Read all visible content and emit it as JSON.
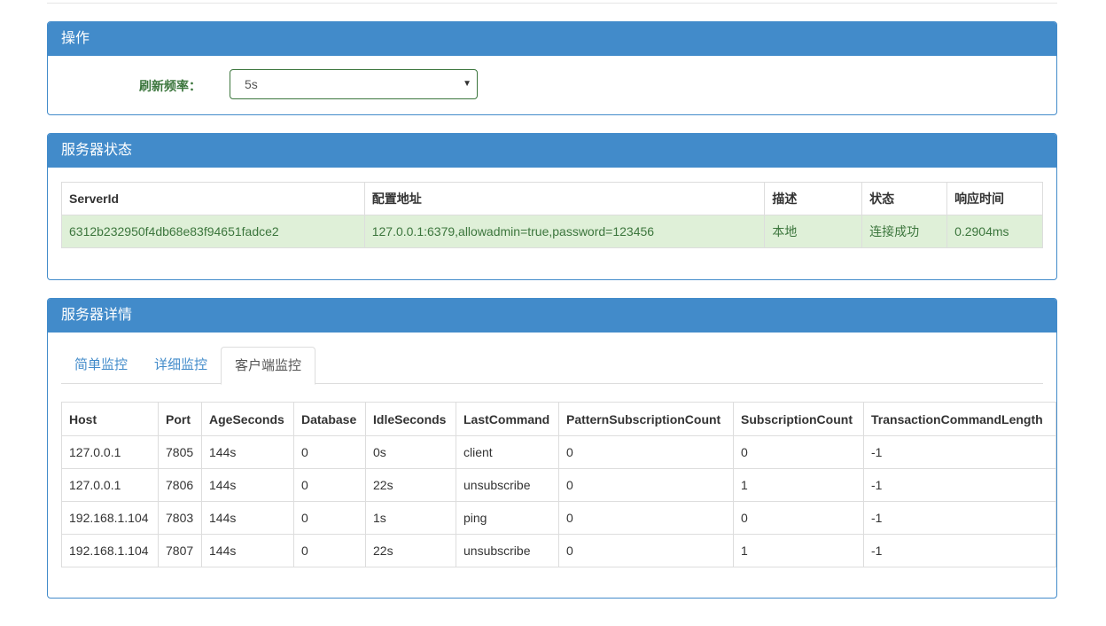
{
  "ops_panel": {
    "title": "操作",
    "refresh_label": "刷新频率：",
    "refresh_value": "5s"
  },
  "status_panel": {
    "title": "服务器状态",
    "headers": [
      "ServerId",
      "配置地址",
      "描述",
      "状态",
      "响应时间"
    ],
    "rows": [
      [
        "6312b232950f4db68e83f94651fadce2",
        "127.0.0.1:6379,allowadmin=true,password=123456",
        "本地",
        "连接成功",
        "0.2904ms"
      ]
    ]
  },
  "details_panel": {
    "title": "服务器详情",
    "tabs": [
      "简单监控",
      "详细监控",
      "客户端监控"
    ],
    "active_tab": 2,
    "headers": [
      "Host",
      "Port",
      "AgeSeconds",
      "Database",
      "IdleSeconds",
      "LastCommand",
      "PatternSubscriptionCount",
      "SubscriptionCount",
      "TransactionCommandLength"
    ],
    "rows": [
      [
        "127.0.0.1",
        "7805",
        "144s",
        "0",
        "0s",
        "client",
        "0",
        "0",
        "-1"
      ],
      [
        "127.0.0.1",
        "7806",
        "144s",
        "0",
        "22s",
        "unsubscribe",
        "0",
        "1",
        "-1"
      ],
      [
        "192.168.1.104",
        "7803",
        "144s",
        "0",
        "1s",
        "ping",
        "0",
        "0",
        "-1"
      ],
      [
        "192.168.1.104",
        "7807",
        "144s",
        "0",
        "22s",
        "unsubscribe",
        "0",
        "1",
        "-1"
      ]
    ]
  },
  "colors": {
    "panel_primary": "#428bca",
    "success_bg": "#dff0d8",
    "success_text": "#3c763d"
  },
  "icons": {
    "select_caret": "caret-down-icon"
  }
}
